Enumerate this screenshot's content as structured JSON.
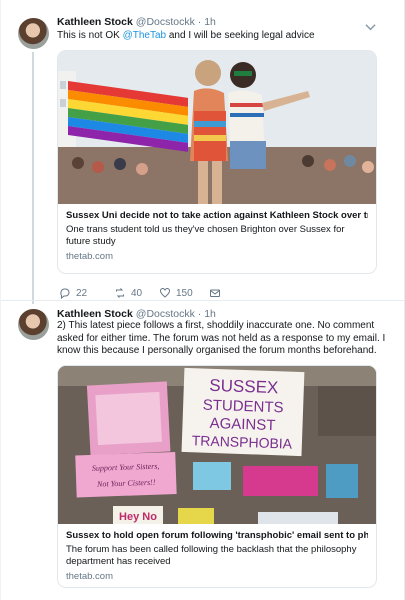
{
  "tweet1": {
    "author_name": "Kathleen Stock",
    "author_handle": "@Docstockk",
    "separator": "·",
    "time": "1h",
    "text_before": "This is not OK ",
    "mention": "@TheTab",
    "text_after": " and I will be seeking legal advice",
    "card": {
      "title": "Sussex Uni decide not to take action against Kathleen Stock over tra...",
      "description": "One trans student told us they've chosen Brighton over Sussex for future study",
      "domain": "thetab.com"
    },
    "actions": {
      "replies": "22",
      "retweets": "40",
      "likes": "150"
    }
  },
  "tweet2": {
    "author_name": "Kathleen Stock",
    "author_handle": "@Docstockk",
    "separator": "·",
    "time": "1h",
    "text": "2) This latest piece follows a first, shoddily inaccurate one. No comment asked for either time. The forum was not held as a response to my email. I know this because I personally organised the forum months beforehand.",
    "image_signs": {
      "sign_main": "SUSSEX STUDENTS AGAINST TRANSPHOBIA",
      "sign_left": "Support Your Sisters, Not Your Cisters!!",
      "sign_bottom": "Hey No"
    },
    "card": {
      "title": "Sussex to hold open forum following 'transphobic' email sent to phil...",
      "description": "The forum has been called following the backlash that the philosophy department has received",
      "domain": "thetab.com"
    }
  },
  "icons": {
    "reply": "reply-icon",
    "retweet": "retweet-icon",
    "like": "heart-icon",
    "dm": "envelope-icon",
    "caret": "chevron-down-icon"
  },
  "colors": {
    "link": "#1b95e0",
    "secondary_text": "#657786",
    "border": "#e1e8ed"
  }
}
